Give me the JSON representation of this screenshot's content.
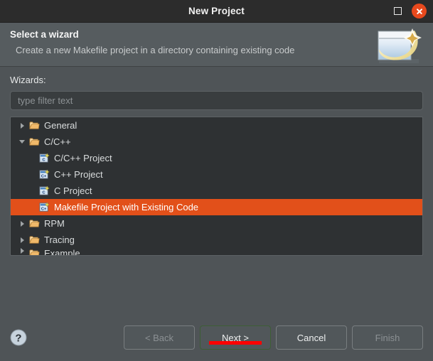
{
  "window": {
    "title": "New Project",
    "controls": {
      "maximize_name": "maximize-icon",
      "close_name": "close-icon"
    }
  },
  "header": {
    "title": "Select a wizard",
    "description": "Create a new Makefile project in a directory containing existing code",
    "banner_icon": "wizard-sparkle-icon"
  },
  "form": {
    "wizards_label": "Wizards:",
    "filter": {
      "value": "",
      "placeholder": "type filter text"
    }
  },
  "tree": {
    "rows": [
      {
        "label": "General",
        "type": "folder",
        "state": "collapsed",
        "level": 0,
        "selected": false,
        "icon": "folder-icon"
      },
      {
        "label": "C/C++",
        "type": "folder",
        "state": "expanded",
        "level": 0,
        "selected": false,
        "icon": "folder-icon"
      },
      {
        "label": "C/C++ Project",
        "type": "leaf",
        "level": 1,
        "selected": false,
        "icon": "c-project-icon"
      },
      {
        "label": "C++ Project",
        "type": "leaf",
        "level": 1,
        "selected": false,
        "icon": "cpp-project-icon"
      },
      {
        "label": "C Project",
        "type": "leaf",
        "level": 1,
        "selected": false,
        "icon": "c-project-icon"
      },
      {
        "label": "Makefile Project with Existing Code",
        "type": "leaf",
        "level": 1,
        "selected": true,
        "icon": "cpp-project-icon"
      },
      {
        "label": "RPM",
        "type": "folder",
        "state": "collapsed",
        "level": 0,
        "selected": false,
        "icon": "folder-icon"
      },
      {
        "label": "Tracing",
        "type": "folder",
        "state": "collapsed",
        "level": 0,
        "selected": false,
        "icon": "folder-icon"
      },
      {
        "label": "Example",
        "type": "folder",
        "state": "collapsed",
        "level": 0,
        "selected": false,
        "icon": "folder-icon",
        "clipped": true
      }
    ]
  },
  "footer": {
    "help_icon": "help-icon",
    "buttons": [
      {
        "label": "< Back",
        "name": "back-button",
        "state": "disabled"
      },
      {
        "label": "Next >",
        "name": "next-button",
        "state": "focused"
      },
      {
        "label": "Cancel",
        "name": "cancel-button",
        "state": "enabled"
      },
      {
        "label": "Finish",
        "name": "finish-button",
        "state": "disabled"
      }
    ]
  },
  "colors": {
    "titlebar_bg": "#2c2c2c",
    "dialog_bg": "#4f5457",
    "header_bg": "#565c5f",
    "tree_bg": "#2e3133",
    "selection": "#e2501a",
    "close_button": "#e8491d",
    "annotation_underline": "#fe0000",
    "focus_border": "#3d5e35"
  }
}
